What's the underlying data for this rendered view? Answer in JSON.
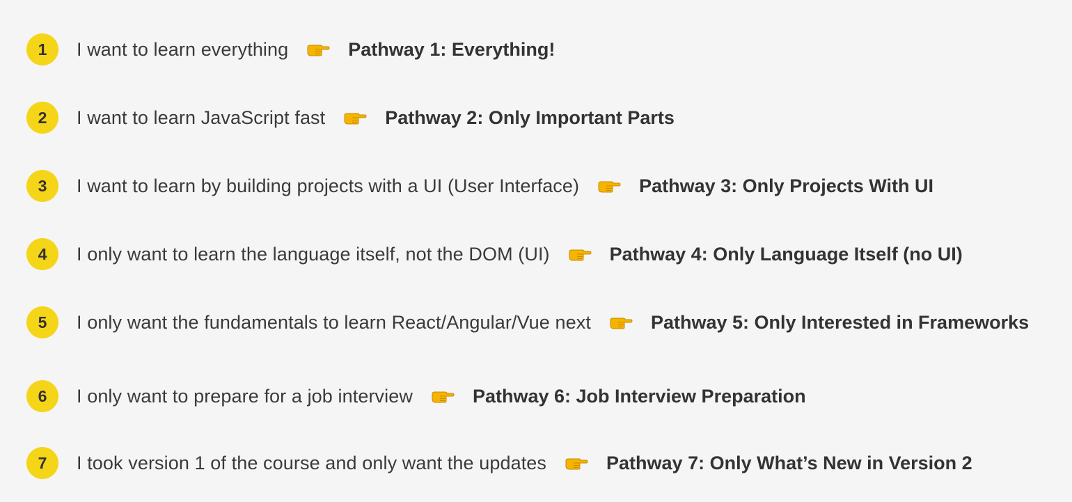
{
  "colors": {
    "background": "#f5f5f5",
    "badge": "#f5d518",
    "text": "#333333",
    "pointer": "#f4b400"
  },
  "icon": "backhand-index-pointing-right-icon",
  "items": [
    {
      "number": "1",
      "description": "I want to learn everything",
      "pathway": "Pathway 1: Everything!"
    },
    {
      "number": "2",
      "description": "I want to learn JavaScript fast",
      "pathway": "Pathway 2: Only Important Parts"
    },
    {
      "number": "3",
      "description": "I want to learn by building projects with a UI (User Interface)",
      "pathway": "Pathway 3: Only Projects With UI"
    },
    {
      "number": "4",
      "description": "I only want to learn the language itself, not the DOM (UI)",
      "pathway": "Pathway 4: Only Language Itself (no UI)"
    },
    {
      "number": "5",
      "description": "I only want the fundamentals to learn React/Angular/Vue next",
      "pathway": "Pathway 5: Only Interested in Frameworks"
    },
    {
      "number": "6",
      "description": "I only want to prepare for a job interview",
      "pathway": "Pathway 6: Job Interview Preparation"
    },
    {
      "number": "7",
      "description": "I took version 1 of the course and only want the updates",
      "pathway": "Pathway 7: Only What’s New in Version 2"
    }
  ]
}
